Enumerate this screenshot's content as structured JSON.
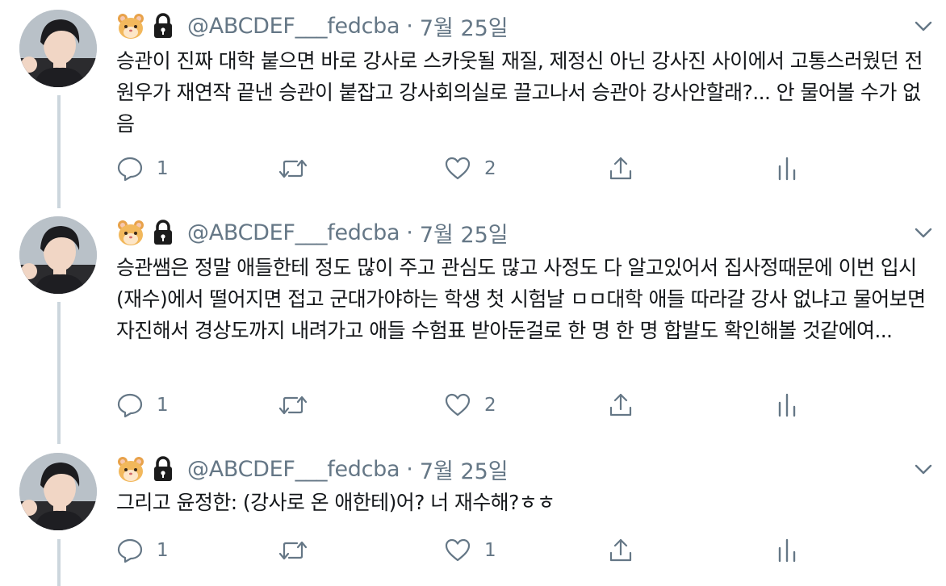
{
  "icons": {
    "emoji": "hamster-face-emoji",
    "lock": "lock-emoji",
    "more": "chevron-down-icon",
    "reply": "reply-icon",
    "retweet": "retweet-icon",
    "like": "heart-icon",
    "share": "share-icon",
    "analytics": "analytics-icon"
  },
  "colors": {
    "secondary_text": "#657786",
    "thread_line": "#ccd6dd",
    "body_text": "#14171a"
  },
  "tweets": [
    {
      "handle": "@ABCDEF___fedcba",
      "separator": "·",
      "date": "7월 25일",
      "text": "승관이 진짜 대학 붙으면 바로 강사로 스카웃될 재질, 제정신 아닌 강사진 사이에서 고통스러웠던 전원우가 재연작 끝낸 승관이 붙잡고 강사회의실로 끌고나서 승관아 강사안할래?... 안 물어볼 수가 없음",
      "reply_count": "1",
      "like_count": "2"
    },
    {
      "handle": "@ABCDEF___fedcba",
      "separator": "·",
      "date": "7월 25일",
      "text": "승관쌤은 정말 애들한테 정도 많이 주고 관심도 많고 사정도 다 알고있어서 집사정때문에 이번 입시(재수)에서 떨어지면 접고 군대가야하는 학생 첫 시험날 ㅁㅁ대학 애들 따라갈 강사 없냐고 물어보면 자진해서 경상도까지 내려가고 애들 수험표 받아둔걸로 한 명 한 명 합발도 확인해볼 것같에여...",
      "reply_count": "1",
      "like_count": "2"
    },
    {
      "handle": "@ABCDEF___fedcba",
      "separator": "·",
      "date": "7월 25일",
      "text": "그리고 윤정한: (강사로 온 애한테)어? 너 재수해?ㅎㅎ",
      "reply_count": "1",
      "like_count": "1"
    }
  ]
}
